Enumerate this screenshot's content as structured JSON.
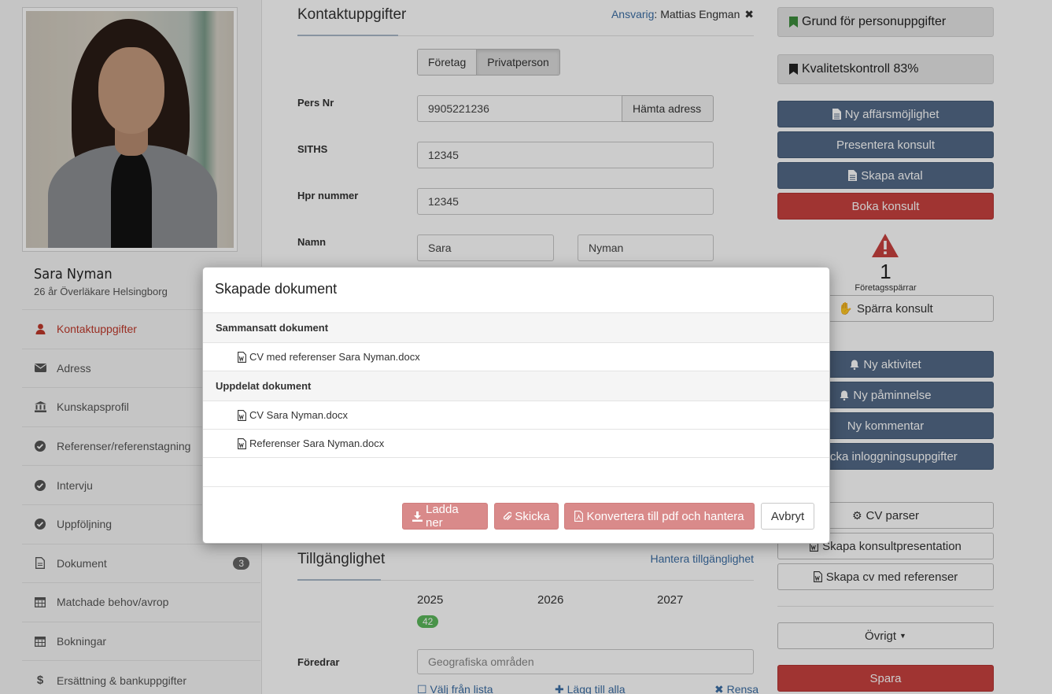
{
  "profile": {
    "name": "Sara Nyman",
    "subtitle": "26 år Överläkare Helsingborg"
  },
  "sidebar": {
    "items": [
      {
        "label": "Kontaktuppgifter",
        "icon": "user-icon",
        "active": true
      },
      {
        "label": "Adress",
        "icon": "envelope-icon"
      },
      {
        "label": "Kunskapsprofil",
        "icon": "institution-icon"
      },
      {
        "label": "Referenser/referenstagning",
        "icon": "check-circle-icon"
      },
      {
        "label": "Intervju",
        "icon": "check-circle-icon"
      },
      {
        "label": "Uppföljning",
        "icon": "check-circle-icon"
      },
      {
        "label": "Dokument",
        "icon": "document-icon",
        "badge": "3"
      },
      {
        "label": "Matchade behov/avrop",
        "icon": "calendar-icon"
      },
      {
        "label": "Bokningar",
        "icon": "calendar-icon"
      },
      {
        "label": "Ersättning & bankuppgifter",
        "icon": "dollar-icon"
      }
    ]
  },
  "contact": {
    "title": "Kontaktuppgifter",
    "responsible_label": "Ansvarig",
    "responsible_name": "Mattias Engman",
    "type_options": [
      "Företag",
      "Privatperson"
    ],
    "type_selected": "Privatperson",
    "persnr_label": "Pers Nr",
    "persnr_value": "9905221236",
    "fetch_address": "Hämta adress",
    "siths_label": "SITHS",
    "siths_value": "12345",
    "hpr_label": "Hpr nummer",
    "hpr_value": "12345",
    "name_label": "Namn",
    "first_name": "Sara",
    "last_name": "Nyman"
  },
  "availability": {
    "title": "Tillgänglighet",
    "manage_link": "Hantera tillgänglighet",
    "years": [
      "2025",
      "2026",
      "2027"
    ],
    "badge_2025": "42",
    "prefers_label": "Föredrar",
    "regions_placeholder": "Geografiska områden",
    "pick_from_list": "Välj från lista",
    "add_all": "Lägg till alla",
    "clear": "Rensa"
  },
  "right": {
    "grounds": "Grund för personuppgifter",
    "quality": "Kvalitetskontroll 83%",
    "new_opportunity": "Ny affärsmöjlighet",
    "present_consultant": "Presentera konsult",
    "create_contract": "Skapa avtal",
    "book_consultant": "Boka konsult",
    "block_count": "1",
    "block_label": "Företagsspärrar",
    "block_consultant": "Spärra konsult",
    "new_activity": "Ny aktivitet",
    "new_reminder": "Ny påminnelse",
    "new_comment": "Ny kommentar",
    "send_login": "Skicka inloggningsuppgifter",
    "cv_parser": "CV parser",
    "create_presentation": "Skapa konsultpresentation",
    "create_cv_refs": "Skapa cv med referenser",
    "other": "Övrigt",
    "save": "Spara"
  },
  "colors": {
    "accent_red": "#c9413f",
    "button_blue": "#536a87",
    "link_blue": "#3b6ea5",
    "badge_green": "#5cb85c"
  },
  "modal": {
    "title": "Skapade dokument",
    "group1_label": "Sammansatt dokument",
    "group1_docs": [
      "CV med referenser Sara Nyman.docx"
    ],
    "group2_label": "Uppdelat dokument",
    "group2_docs": [
      "CV Sara Nyman.docx",
      "Referenser Sara Nyman.docx"
    ],
    "download": "Ladda ner",
    "send": "Skicka",
    "convert": "Konvertera till pdf och hantera",
    "cancel": "Avbryt"
  }
}
